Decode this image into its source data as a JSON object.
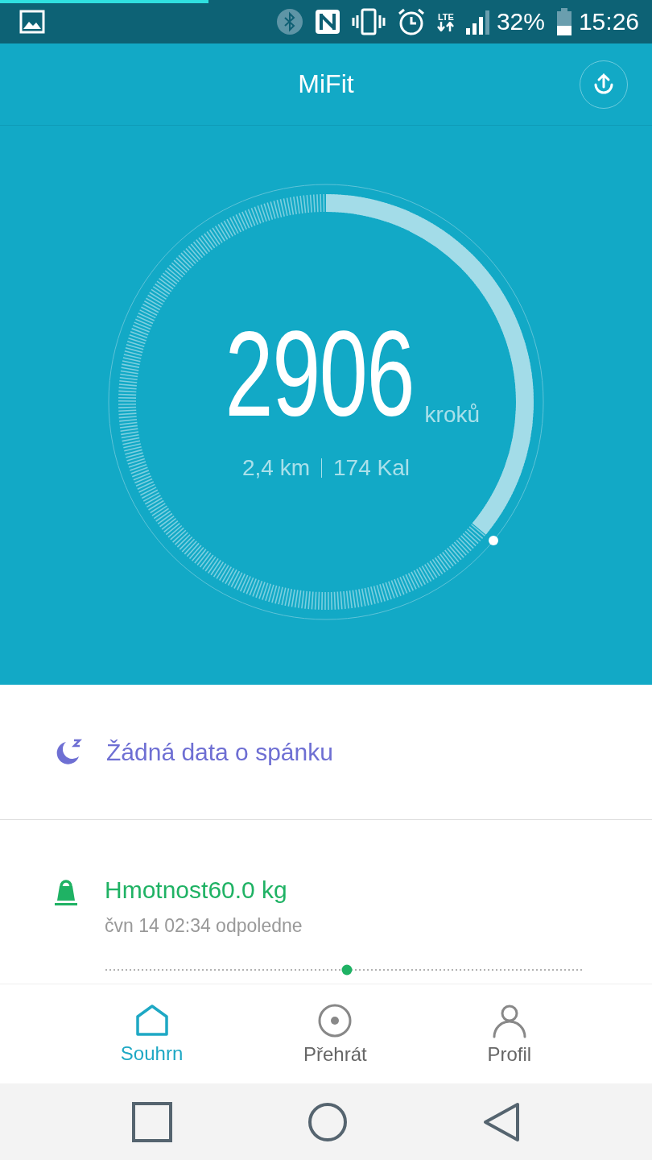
{
  "status_bar": {
    "network_label": "LTE",
    "battery": "32%",
    "time": "15:26",
    "load_bar": {
      "level": 0.32
    }
  },
  "app_bar": {
    "title": "MiFit"
  },
  "steps": {
    "count": "2906",
    "unit": "kroků",
    "distance": "2,4 km",
    "calories": "174 Kal",
    "level": 0.36
  },
  "cards": [
    {
      "kind": "sleep",
      "title": "Žádná data o spánku"
    },
    {
      "kind": "weight",
      "title": "Hmotnost60.0 kg",
      "subtitle": "čvn 14 02:34 odpoledne"
    }
  ],
  "tabs": [
    {
      "label": "Souhrn",
      "kind": "home",
      "selected": true
    },
    {
      "label": "Přehrát",
      "kind": "play",
      "selected": false
    },
    {
      "label": "Profil",
      "kind": "person",
      "selected": false
    }
  ]
}
